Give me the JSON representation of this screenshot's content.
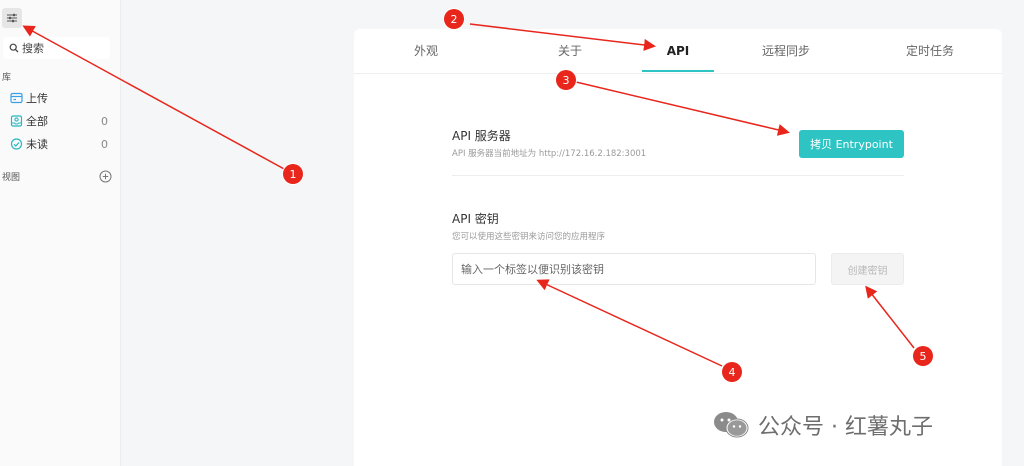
{
  "sidebar": {
    "search_placeholder": "搜索",
    "library_heading": "库",
    "items": [
      {
        "label": "上传",
        "count": ""
      },
      {
        "label": "全部",
        "count": "0"
      },
      {
        "label": "未读",
        "count": "0"
      }
    ],
    "views_heading": "视图"
  },
  "tabs": [
    {
      "label": "外观"
    },
    {
      "label": "关于"
    },
    {
      "label": "API",
      "active": true
    },
    {
      "label": "远程同步"
    },
    {
      "label": "定时任务"
    }
  ],
  "api_server": {
    "title": "API 服务器",
    "subtitle": "API 服务器当前地址为 http://172.16.2.182:3001",
    "copy_button": "拷贝 Entrypoint"
  },
  "api_key": {
    "title": "API 密钥",
    "subtitle": "您可以使用这些密钥来访问您的应用程序",
    "input_placeholder": "输入一个标签以便识别该密钥",
    "create_button": "创建密钥"
  },
  "annotations": [
    {
      "number": "1"
    },
    {
      "number": "2"
    },
    {
      "number": "3"
    },
    {
      "number": "4"
    },
    {
      "number": "5"
    }
  ],
  "watermark": {
    "text": "公众号 · 红薯丸子"
  },
  "colors": {
    "accent": "#2ec4c4",
    "annotation": "#e8261c",
    "icon_blue": "#3aa0e6",
    "icon_teal": "#2ab7c2"
  }
}
